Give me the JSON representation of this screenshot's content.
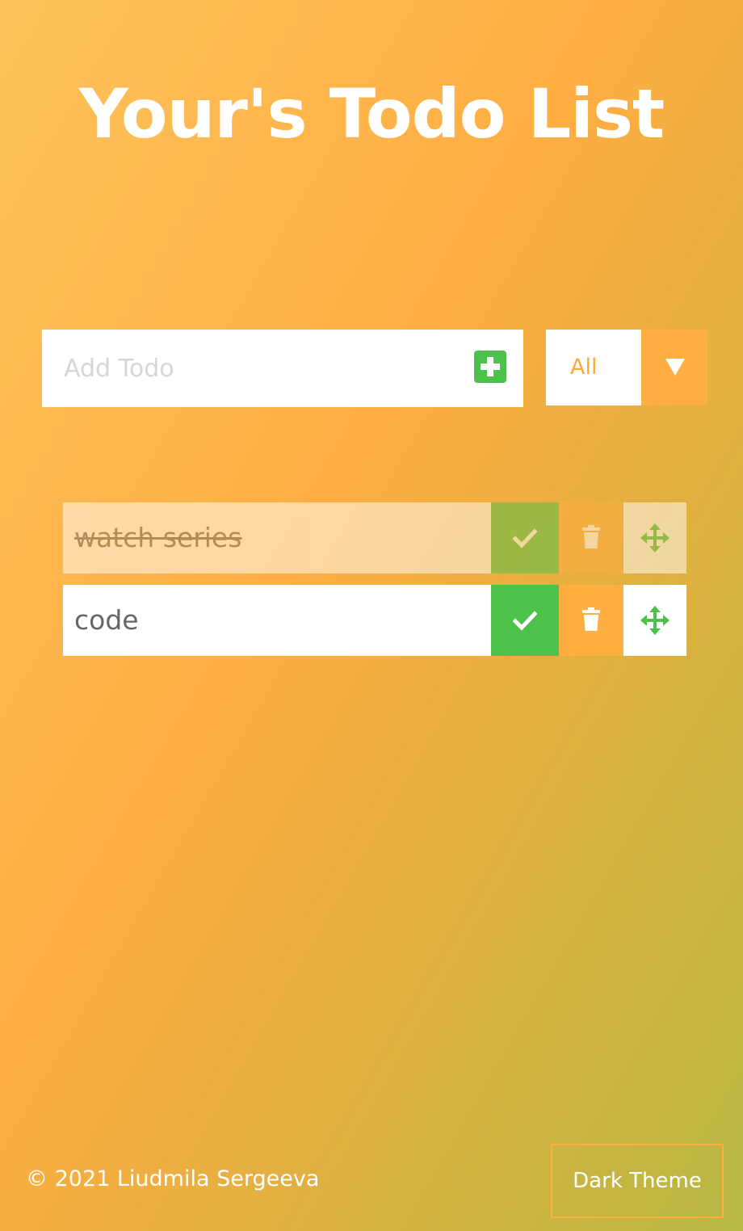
{
  "header": {
    "title": "Your's Todo List"
  },
  "add_todo": {
    "placeholder": "Add Todo",
    "value": "",
    "add_icon": "plus-square-icon"
  },
  "filter": {
    "selected": "All",
    "arrow_icon": "caret-down-icon"
  },
  "todos": [
    {
      "text": "watch series",
      "completed": true,
      "icons": [
        "check-icon",
        "trash-icon",
        "move-arrows-icon"
      ]
    },
    {
      "text": "code",
      "completed": false,
      "icons": [
        "check-icon",
        "trash-icon",
        "move-arrows-icon"
      ]
    }
  ],
  "footer": {
    "copyright": "© 2021 Liudmila Sergeeva",
    "theme_button": "Dark Theme"
  },
  "colors": {
    "accent_orange": "#ffae40",
    "accent_green": "#4cc24a",
    "background_start": "#fdc35c",
    "background_end": "#b7b743",
    "text_dark": "#676767"
  }
}
